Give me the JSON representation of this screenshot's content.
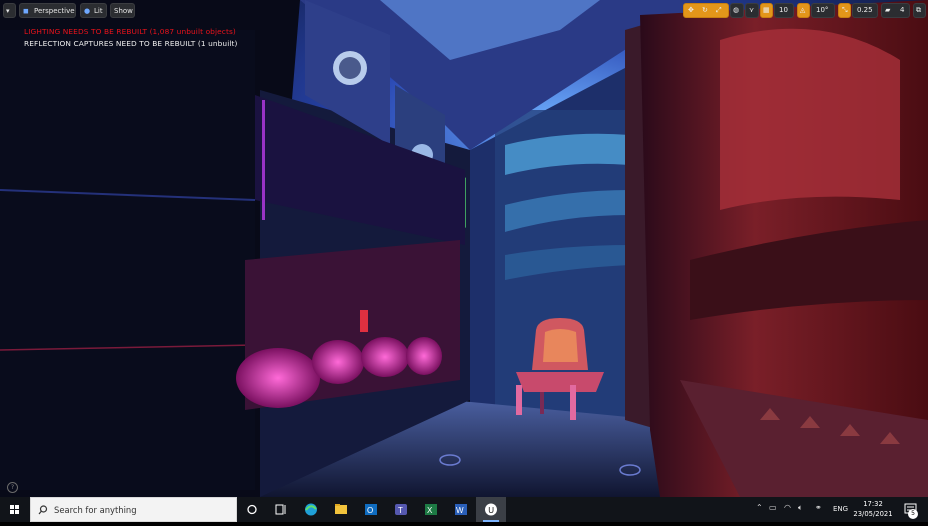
{
  "viewport": {
    "toolbar": {
      "menu_icon": "chevron-down-icon",
      "perspective_label": "Perspective",
      "lit_label": "Lit",
      "show_label": "Show"
    },
    "messages": {
      "lighting": "LIGHTING NEEDS TO BE REBUILT (1,087 unbuilt objects)",
      "reflection": "REFLECTION CAPTURES NEED TO BE REBUILT (1 unbuilt)"
    },
    "right_toolbar": {
      "grid_snap_value": "10",
      "rotation_snap_value": "10°",
      "scale_snap_value": "0.25",
      "camera_speed_value": "4"
    },
    "accent_color": "#e3961a",
    "warning_color": "#e8131b"
  },
  "taskbar": {
    "search_placeholder": "Search for anything",
    "language": "ENG",
    "time": "17:32",
    "date": "23/05/2021",
    "notification_count": "5",
    "apps": [
      "cortana-icon",
      "task-view-icon",
      "edge-icon",
      "file-explorer-icon",
      "outlook-icon",
      "teams-icon",
      "excel-icon",
      "word-icon",
      "unreal-engine-icon"
    ]
  }
}
